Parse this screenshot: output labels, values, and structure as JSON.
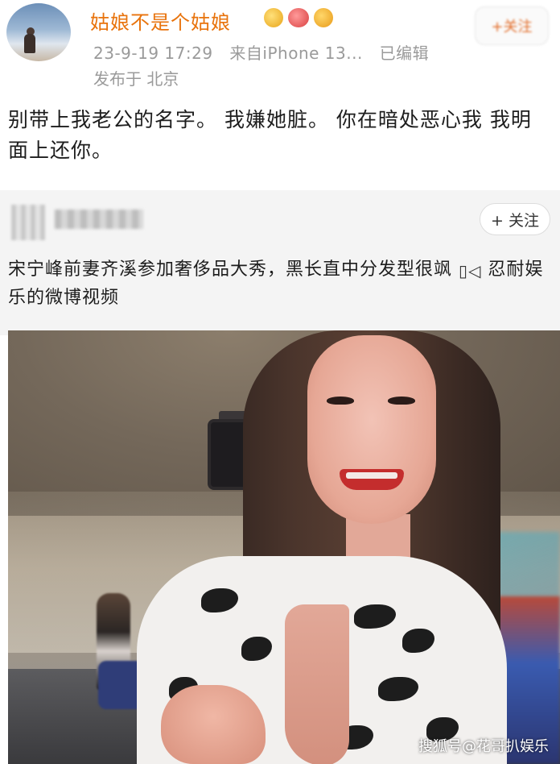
{
  "post": {
    "username": "姑娘不是个姑娘",
    "timestamp": "23-9-19 17:29",
    "source": "来自iPhone 13...",
    "edited": "已编辑",
    "location": "发布于 北京",
    "text": "别带上我老公的名字。  我嫌她脏。 你在暗处恶心我  我明面上还你。",
    "top_right_button": "+关注"
  },
  "embed": {
    "follow_label": "+ 关注",
    "text": "宋宁峰前妻齐溪参加奢侈品大秀，黑长直中分发型很飒",
    "video_icon": "video-camera-icon",
    "text_suffix": "忍耐娱乐的微博视频"
  },
  "watermark": "搜狐号@花哥扒娱乐",
  "colors": {
    "username": "#e8730c",
    "meta": "#9a9a9a",
    "embed_bg": "#f4f4f4"
  }
}
